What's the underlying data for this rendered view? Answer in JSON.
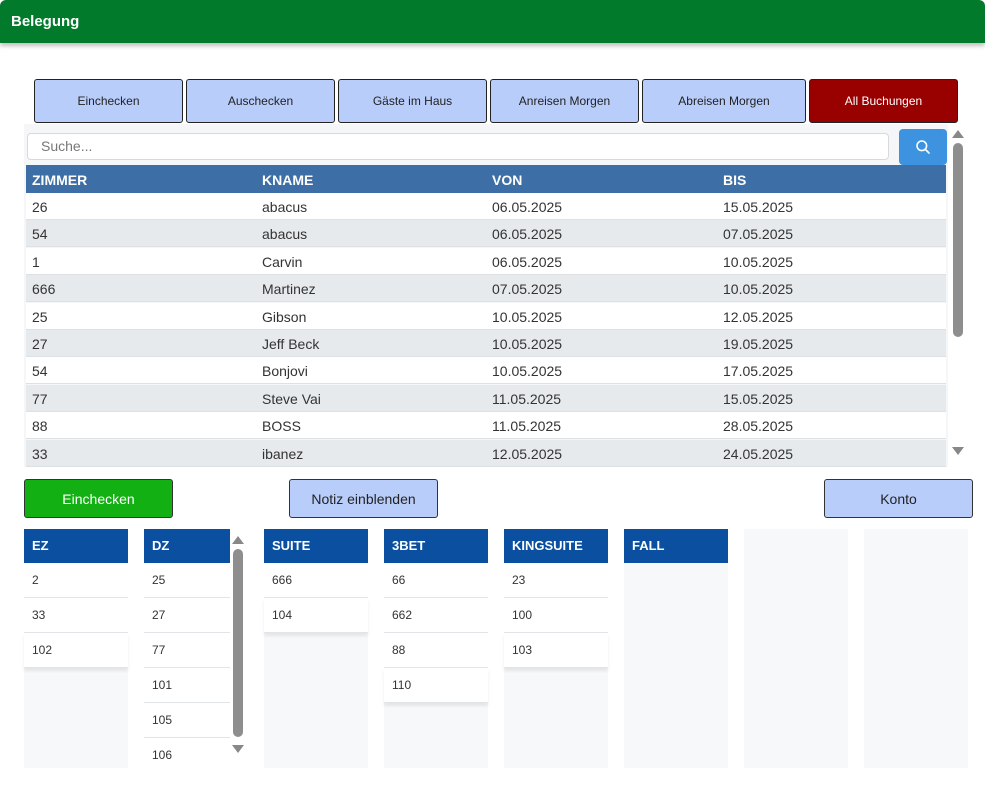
{
  "window": {
    "title": "Belegung"
  },
  "tabs": [
    {
      "label": "Einchecken"
    },
    {
      "label": "Auschecken"
    },
    {
      "label": "Gäste im Haus"
    },
    {
      "label": "Anreisen Morgen"
    },
    {
      "label": "Abreisen Morgen"
    },
    {
      "label": "All Buchungen"
    }
  ],
  "search": {
    "placeholder": "Suche..."
  },
  "table": {
    "headers": [
      "ZIMMER",
      "KNAME",
      "VON",
      "BIS"
    ],
    "rows": [
      [
        "26",
        "abacus",
        "06.05.2025",
        "15.05.2025"
      ],
      [
        "54",
        "abacus",
        "06.05.2025",
        "07.05.2025"
      ],
      [
        "1",
        "Carvin",
        "06.05.2025",
        "10.05.2025"
      ],
      [
        "666",
        "Martinez",
        "07.05.2025",
        "10.05.2025"
      ],
      [
        "25",
        "Gibson",
        "10.05.2025",
        "12.05.2025"
      ],
      [
        "27",
        "Jeff Beck",
        "10.05.2025",
        "19.05.2025"
      ],
      [
        "54",
        "Bonjovi",
        "10.05.2025",
        "17.05.2025"
      ],
      [
        "77",
        "Steve Vai",
        "11.05.2025",
        "15.05.2025"
      ],
      [
        "88",
        "BOSS",
        "11.05.2025",
        "28.05.2025"
      ],
      [
        "33",
        "ibanez",
        "12.05.2025",
        "24.05.2025"
      ]
    ]
  },
  "actions": {
    "checkin": "Einchecken",
    "notes": "Notiz einblenden",
    "account": "Konto"
  },
  "categories": [
    {
      "name": "EZ",
      "rooms": [
        "2",
        "33",
        "102"
      ]
    },
    {
      "name": "DZ",
      "rooms": [
        "25",
        "27",
        "77",
        "101",
        "105",
        "106"
      ]
    },
    {
      "name": "SUITE",
      "rooms": [
        "666",
        "104"
      ]
    },
    {
      "name": "3BET",
      "rooms": [
        "66",
        "662",
        "88",
        "110"
      ]
    },
    {
      "name": "KINGSUITE",
      "rooms": [
        "23",
        "100",
        "103"
      ]
    },
    {
      "name": "FALL",
      "rooms": []
    }
  ],
  "colors": {
    "titlebar": "#027a2c",
    "tab": "#b9cdfb",
    "tab_active": "#990000",
    "table_header": "#3d6fa6",
    "category_header": "#0a4fa0",
    "checkin_button": "#12b012",
    "search_button": "#3d93e0"
  },
  "icons": {
    "search": "search-icon"
  }
}
